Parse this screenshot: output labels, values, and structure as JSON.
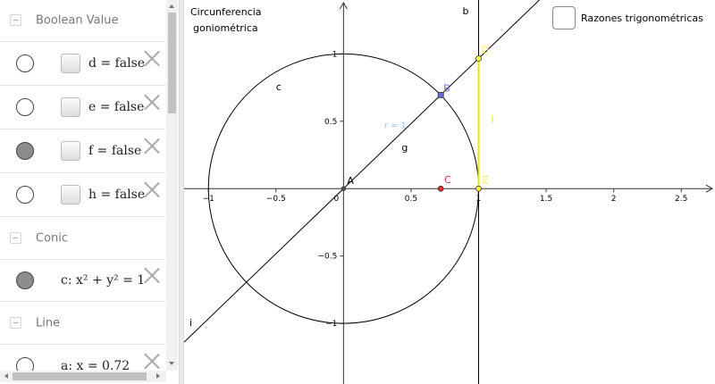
{
  "algebra": {
    "groups": {
      "boolean": "Boolean Value",
      "conic": "Conic",
      "line": "Line"
    },
    "rows": {
      "d": {
        "text": "d = false",
        "visible": false
      },
      "e": {
        "text": "e = false",
        "visible": false
      },
      "f": {
        "text": "f = false",
        "visible": true
      },
      "h": {
        "text": "h = false",
        "visible": false
      },
      "c": {
        "text": "c: x² + y² = 1",
        "visible": true
      },
      "a": {
        "text": "a: x = 0.72",
        "visible": false
      }
    }
  },
  "graphics": {
    "title_line1": "Circunferencia",
    "title_line2": "goniométrica",
    "checkbox_label": "Razones trigonométricas",
    "labels": {
      "b": "b",
      "c": "c",
      "g": "g",
      "i": "i",
      "l": "l",
      "r": "r = 1",
      "A": "A",
      "B": "B",
      "C": "C",
      "D": "D",
      "E": "E"
    },
    "x_ticks": [
      "−1",
      "−0.5",
      "0",
      "0.5",
      "1",
      "1.5",
      "2",
      "2.5"
    ],
    "y_ticks": [
      "1",
      "0.5",
      "−0.5",
      "−1"
    ],
    "colors": {
      "axis": "#333333",
      "circle": "#000000",
      "tangent_segment": "#e6e600",
      "point_B": "#6b6bd6",
      "point_C": "#e03030",
      "point_yellow": "#ffff33",
      "radius_label": "#9fc3ff"
    }
  },
  "chart_data": {
    "type": "geometry",
    "circle": {
      "center": [
        0,
        0
      ],
      "radius": 1
    },
    "line_through_origin_slope": 0.9657,
    "tangent_line_x": 1,
    "points": {
      "A": [
        0,
        0
      ],
      "B": [
        0.72,
        0.695
      ],
      "C": [
        0.72,
        0
      ],
      "D": [
        1,
        0.9657
      ],
      "E": [
        1,
        0
      ]
    },
    "xlim": [
      -1.18,
      2.75
    ],
    "ylim": [
      -1.45,
      1.4
    ]
  }
}
